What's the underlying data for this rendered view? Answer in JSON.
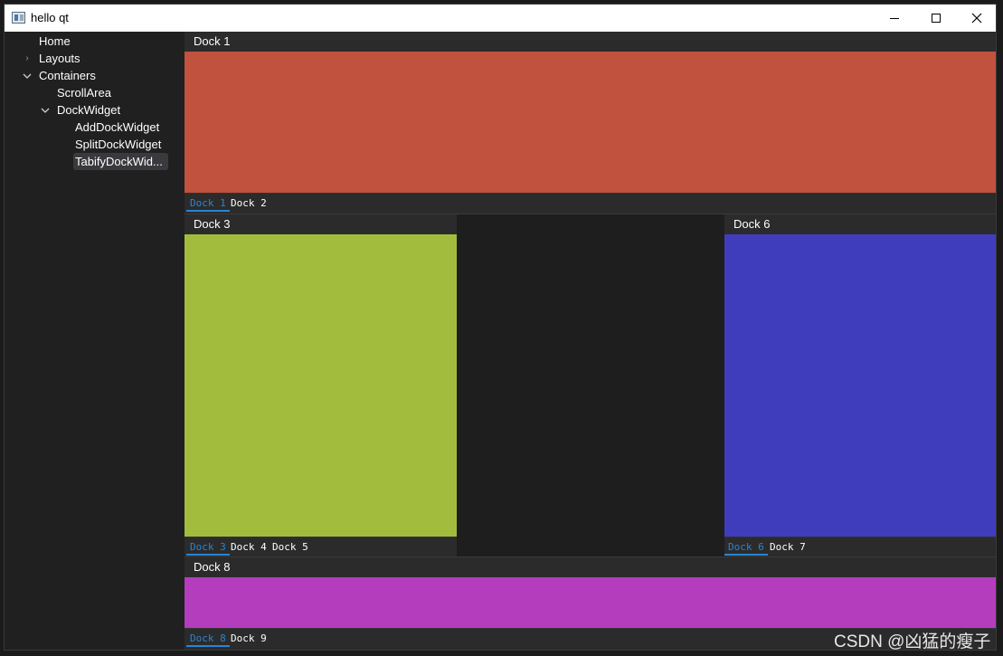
{
  "window": {
    "title": "hello qt",
    "controls": {
      "minimize": "min-icon",
      "maximize": "max-icon",
      "close": "close-icon"
    }
  },
  "sidebar": {
    "items": [
      {
        "label": "Home",
        "level": 0,
        "expander": "none"
      },
      {
        "label": "Layouts",
        "level": 0,
        "expander": "collapsed"
      },
      {
        "label": "Containers",
        "level": 0,
        "expander": "expanded"
      },
      {
        "label": "ScrollArea",
        "level": 1,
        "expander": "none"
      },
      {
        "label": "DockWidget",
        "level": 1,
        "expander": "expanded"
      },
      {
        "label": "AddDockWidget",
        "level": 2,
        "expander": "none"
      },
      {
        "label": "SplitDockWidget",
        "level": 2,
        "expander": "none"
      },
      {
        "label": "TabifyDockWid...",
        "level": 2,
        "expander": "none",
        "selected": true
      }
    ]
  },
  "docks": {
    "top": {
      "title": "Dock 1",
      "color": "#c0523e",
      "tabs": [
        {
          "label": "Dock 1",
          "active": true
        },
        {
          "label": "Dock 2",
          "active": false
        }
      ]
    },
    "left": {
      "title": "Dock 3",
      "color": "#a2bd3e",
      "tabs": [
        {
          "label": "Dock 3",
          "active": true
        },
        {
          "label": "Dock 4",
          "active": false
        },
        {
          "label": "Dock 5",
          "active": false
        }
      ]
    },
    "right": {
      "title": "Dock 6",
      "color": "#403dbd",
      "tabs": [
        {
          "label": "Dock 6",
          "active": true
        },
        {
          "label": "Dock 7",
          "active": false
        }
      ]
    },
    "bottom": {
      "title": "Dock 8",
      "color": "#b33dbd",
      "tabs": [
        {
          "label": "Dock 8",
          "active": true
        },
        {
          "label": "Dock 9",
          "active": false
        }
      ]
    }
  },
  "watermark": "CSDN @凶猛的瘦子",
  "colors": {
    "accent": "#2a84d2",
    "central_background": "#1e1e1e"
  }
}
